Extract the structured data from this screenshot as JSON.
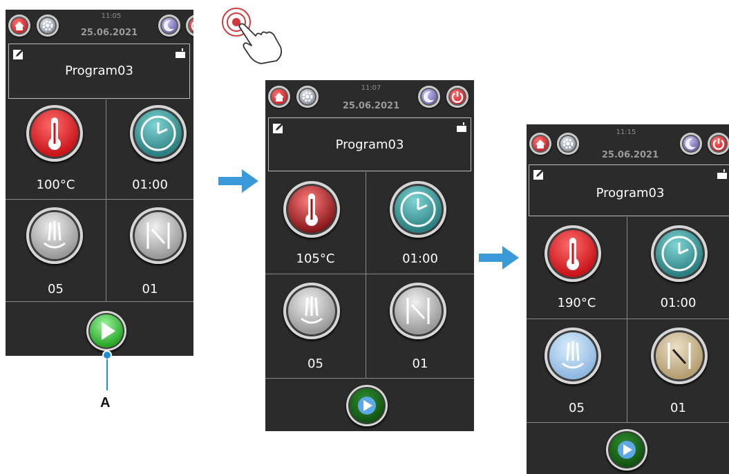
{
  "screens": [
    {
      "time": "11:05",
      "date": "25.06.2021",
      "program": "Program03",
      "temperature": "100°C",
      "timer": "01:00",
      "steam": "05",
      "flap": "01"
    },
    {
      "time": "11:07",
      "date": "25.06.2021",
      "program": "Program03",
      "temperature": "105°C",
      "timer": "01:00",
      "steam": "05",
      "flap": "01"
    },
    {
      "time": "11:15",
      "date": "25.06.2021",
      "program": "Program03",
      "temperature": "190°C",
      "timer": "01:00",
      "steam": "05",
      "flap": "01"
    }
  ],
  "callout": {
    "label": "A"
  },
  "colors": {
    "panel": "#2b2b2b",
    "accent_arrow": "#3a9ad9",
    "start_green": "#3cc43c",
    "temp_red": "#d8262b",
    "clock_teal": "#2e8f8f",
    "steam_blue": "#a9c9e8",
    "flap_tan": "#c9b48a"
  },
  "icons": {
    "home": "home-icon",
    "settings": "gear-icon",
    "night": "moon-icon",
    "power": "power-icon",
    "edit": "edit-icon",
    "door": "door-icon",
    "temperature": "thermometer-icon",
    "timer": "clock-icon",
    "steam": "steam-icon",
    "flap": "flap-icon",
    "start": "play-icon",
    "tap": "tap-hand-icon"
  }
}
